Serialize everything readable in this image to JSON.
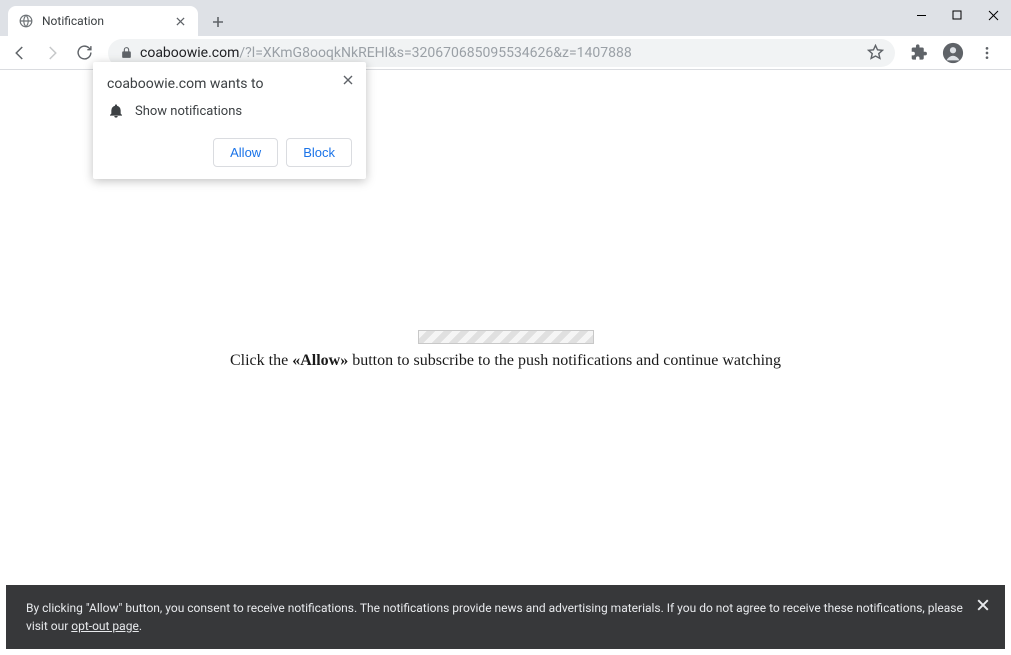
{
  "window": {
    "tab_title": "Notification"
  },
  "toolbar": {
    "url_host": "coaboowie.com",
    "url_rest": "/?l=XKmG8ooqkNkREHl&s=320670685095534626&z=1407888"
  },
  "permission": {
    "title": "coaboowie.com wants to",
    "label": "Show notifications",
    "allow": "Allow",
    "block": "Block"
  },
  "page": {
    "msg_prefix": "Click the ",
    "msg_bold": "«Allow»",
    "msg_suffix": " button to subscribe to the push notifications and continue watching"
  },
  "footer": {
    "text1": "By clicking \"Allow\" button, you consent to receive notifications. The notifications provide news and advertising materials. If you do not agree to receive these notifications, please visit our ",
    "link": "opt-out page",
    "text2": "."
  }
}
